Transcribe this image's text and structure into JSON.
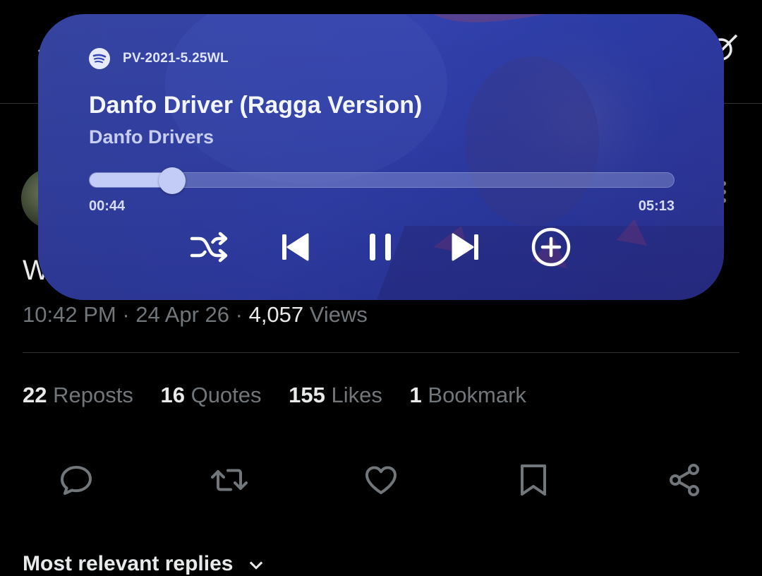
{
  "tweet": {
    "partial_text": "W",
    "time": "10:42 PM",
    "date": "24 Apr 26",
    "views_count": "4,057",
    "views_label": "Views",
    "separator": "·"
  },
  "stats": [
    {
      "num": "22",
      "label": "Reposts"
    },
    {
      "num": "16",
      "label": "Quotes"
    },
    {
      "num": "155",
      "label": "Likes"
    },
    {
      "num": "1",
      "label": "Bookmark"
    }
  ],
  "replies_heading": "Most relevant replies",
  "player": {
    "app_name": "PV-2021-5.25WL",
    "title": "Danfo Driver (Ragga Version)",
    "artist": "Danfo Drivers",
    "elapsed": "00:44",
    "duration": "05:13",
    "progress": 0.141
  },
  "icons": {
    "top": [
      "back-arrow-icon",
      "grok-icon"
    ],
    "player": [
      "spotify-icon",
      "shuffle-icon",
      "previous-icon",
      "pause-icon",
      "next-icon",
      "add-circle-icon"
    ],
    "actions": [
      "reply-icon",
      "repost-icon",
      "like-icon",
      "bookmark-icon",
      "share-icon"
    ]
  },
  "colors": {
    "background": "#000000",
    "text_primary": "#e7e9ea",
    "text_secondary": "#71767b",
    "divider": "#2f3336",
    "player_tint": "#3848b8",
    "seek_fill": "#c3cbf7"
  }
}
